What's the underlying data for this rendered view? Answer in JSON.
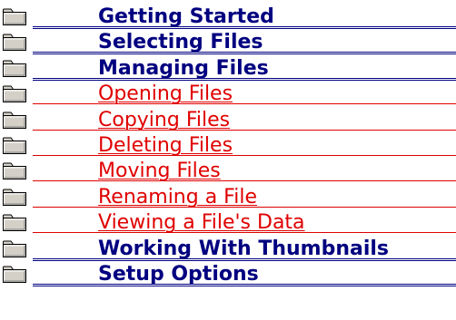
{
  "toc": {
    "colors": {
      "heading": "#000080",
      "topic": "#e00000",
      "folder_fill": "#d4d0c8"
    },
    "items": [
      {
        "label": "Getting Started",
        "kind": "heading",
        "icon": "folder-icon"
      },
      {
        "label": "Selecting Files",
        "kind": "heading",
        "icon": "folder-icon"
      },
      {
        "label": "Managing Files",
        "kind": "heading",
        "icon": "folder-icon"
      },
      {
        "label": "Opening Files",
        "kind": "topic",
        "icon": "folder-icon"
      },
      {
        "label": "Copying Files",
        "kind": "topic",
        "icon": "folder-icon"
      },
      {
        "label": "Deleting Files",
        "kind": "topic",
        "icon": "folder-icon"
      },
      {
        "label": "Moving Files",
        "kind": "topic",
        "icon": "folder-icon"
      },
      {
        "label": "Renaming a File",
        "kind": "topic",
        "icon": "folder-icon"
      },
      {
        "label": "Viewing a File's Data",
        "kind": "topic",
        "icon": "folder-icon"
      },
      {
        "label": "Working With Thumbnails",
        "kind": "heading",
        "icon": "folder-icon"
      },
      {
        "label": "Setup Options",
        "kind": "heading",
        "icon": "folder-icon"
      }
    ]
  }
}
